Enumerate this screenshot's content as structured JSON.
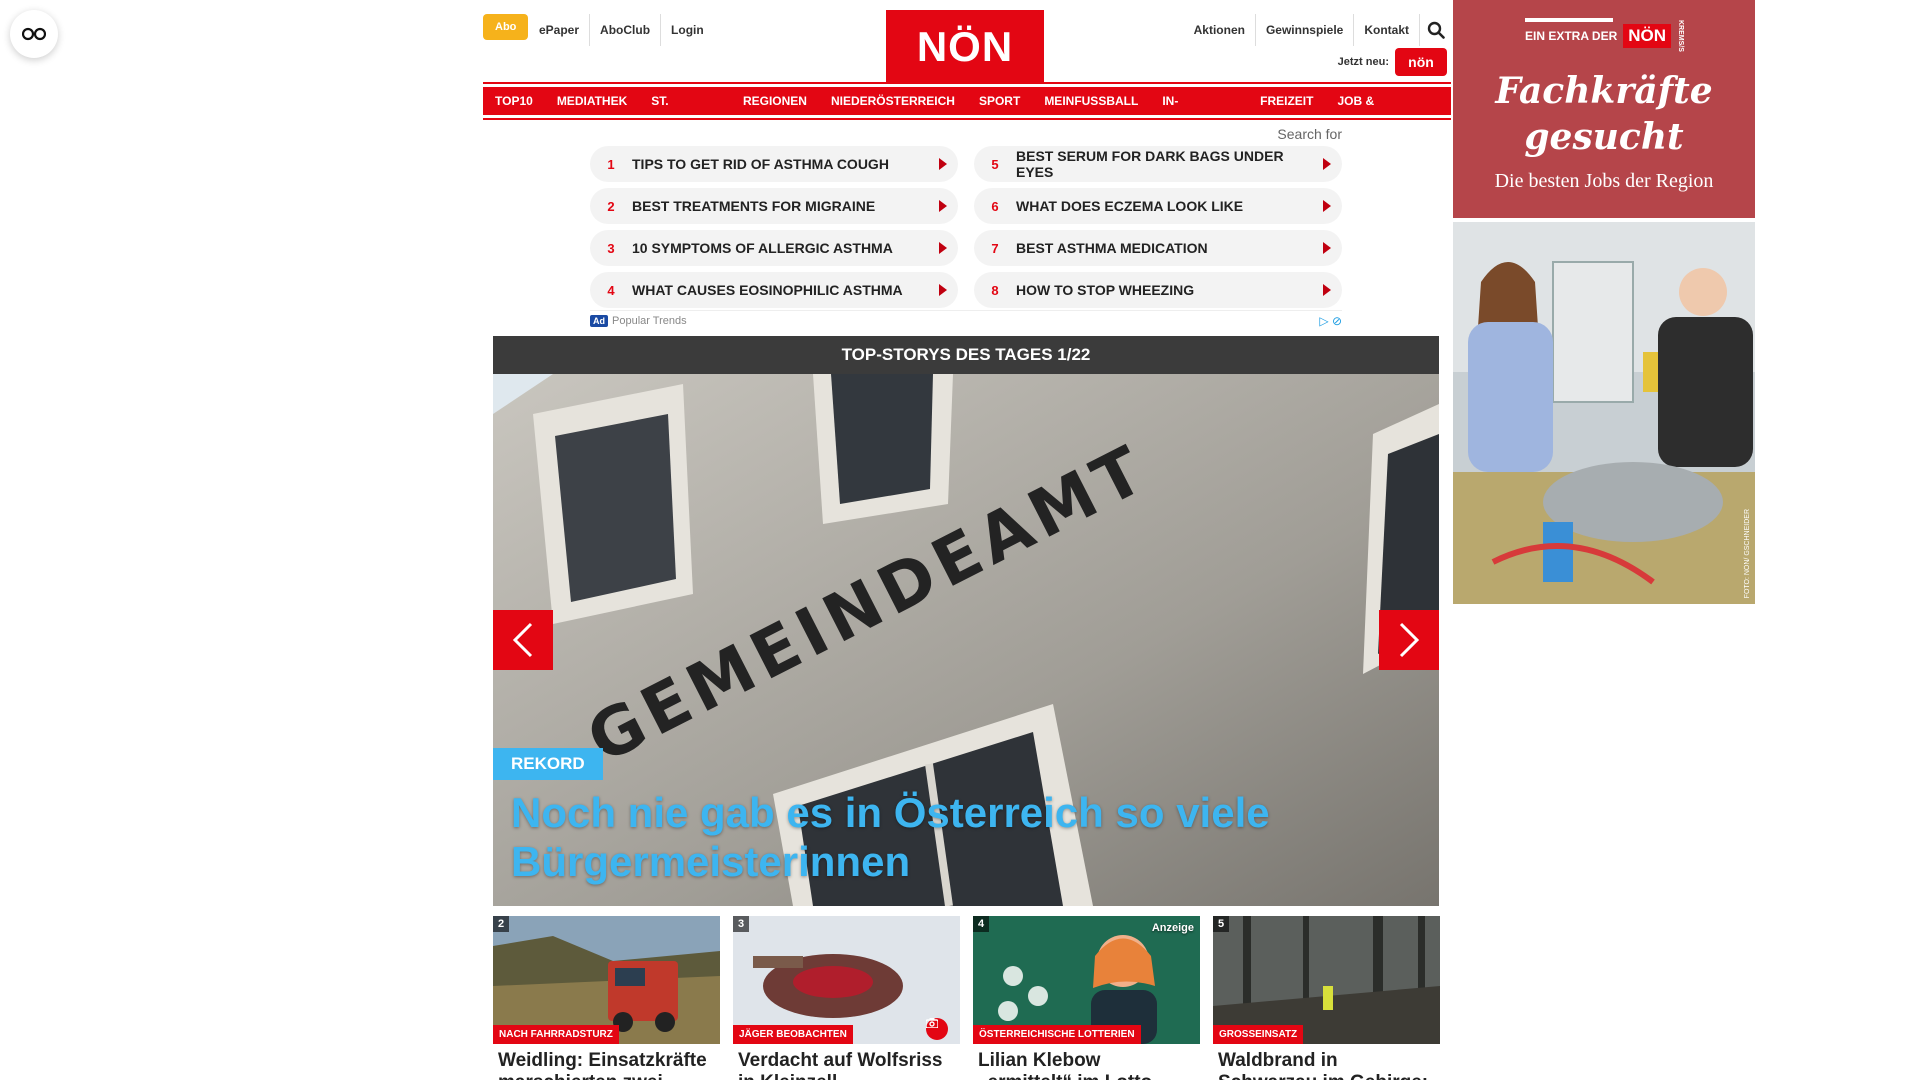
{
  "header": {
    "abo_label": "Abo",
    "left_links": [
      "ePaper",
      "AboClub",
      "Login"
    ],
    "right_links": [
      "Aktionen",
      "Gewinnspiele",
      "Kontakt"
    ],
    "logo_text": "NÖN",
    "jetzt_label": "Jetzt neu:",
    "jetzt_badge": "nön"
  },
  "nav": {
    "items": [
      "TOP10",
      "MEDIATHEK",
      "ST. PÖLTEN",
      "REGIONEN",
      "NIEDERÖSTERREICH",
      "SPORT",
      "MEINFUSSBALL",
      "IN-AUSLAND",
      "FREIZEIT",
      "JOB & KARRIERE"
    ]
  },
  "ads": {
    "search_label": "Search for",
    "items": [
      {
        "num": "1",
        "text": "TIPS TO GET RID OF ASTHMA COUGH"
      },
      {
        "num": "5",
        "text": "BEST SERUM FOR DARK BAGS UNDER EYES"
      },
      {
        "num": "2",
        "text": "BEST TREATMENTS FOR MIGRAINE"
      },
      {
        "num": "6",
        "text": "WHAT DOES ECZEMA LOOK LIKE"
      },
      {
        "num": "3",
        "text": "10 SYMPTOMS OF ALLERGIC ASTHMA"
      },
      {
        "num": "7",
        "text": "BEST ASTHMA MEDICATION"
      },
      {
        "num": "4",
        "text": "WHAT CAUSES EOSINOPHILIC ASTHMA"
      },
      {
        "num": "8",
        "text": "HOW TO STOP WHEEZING"
      }
    ],
    "footer_badge": "Ad",
    "footer_label": "Popular Trends"
  },
  "top_stories": {
    "title": "TOP-STORYS DES TAGES 1/22",
    "hero": {
      "tag": "REKORD",
      "headline": "Noch nie gab es in Österreich so viele Bürgermeisterinnen",
      "sign_text": "GEMEINDEAMT"
    },
    "cards": [
      {
        "num": "2",
        "kicker": "NACH FAHRRADSTURZ",
        "title": "Weidling: Einsatzkräfte marschierten zwei"
      },
      {
        "num": "3",
        "kicker": "JÄGER BEOBACHTEN",
        "title": "Verdacht auf Wolfsriss in Kleinzell"
      },
      {
        "num": "4",
        "kicker": "ÖSTERREICHISCHE LOTTERIEN",
        "badge": "Anzeige",
        "title": "Lilian Klebow „ermittelt“ im Lotto Studio"
      },
      {
        "num": "5",
        "kicker": "GROSSEINSATZ",
        "title": "Waldbrand in Schwarzau im Gebirge:"
      }
    ]
  },
  "side_ad": {
    "extra_label": "EIN EXTRA DER",
    "logo": "NÖN",
    "vertical_tag": "KREMS/S",
    "headline_1": "Fachkräfte",
    "headline_2": "gesucht",
    "subline": "Die besten Jobs der Region",
    "credit": "FOTO: NÖN/ GSCHNEIDER"
  },
  "colors": {
    "brand_red": "#e30613",
    "abo_yellow": "#f6b21b",
    "hero_blue": "#3db5f0",
    "side_ad_red": "#b5454a"
  }
}
